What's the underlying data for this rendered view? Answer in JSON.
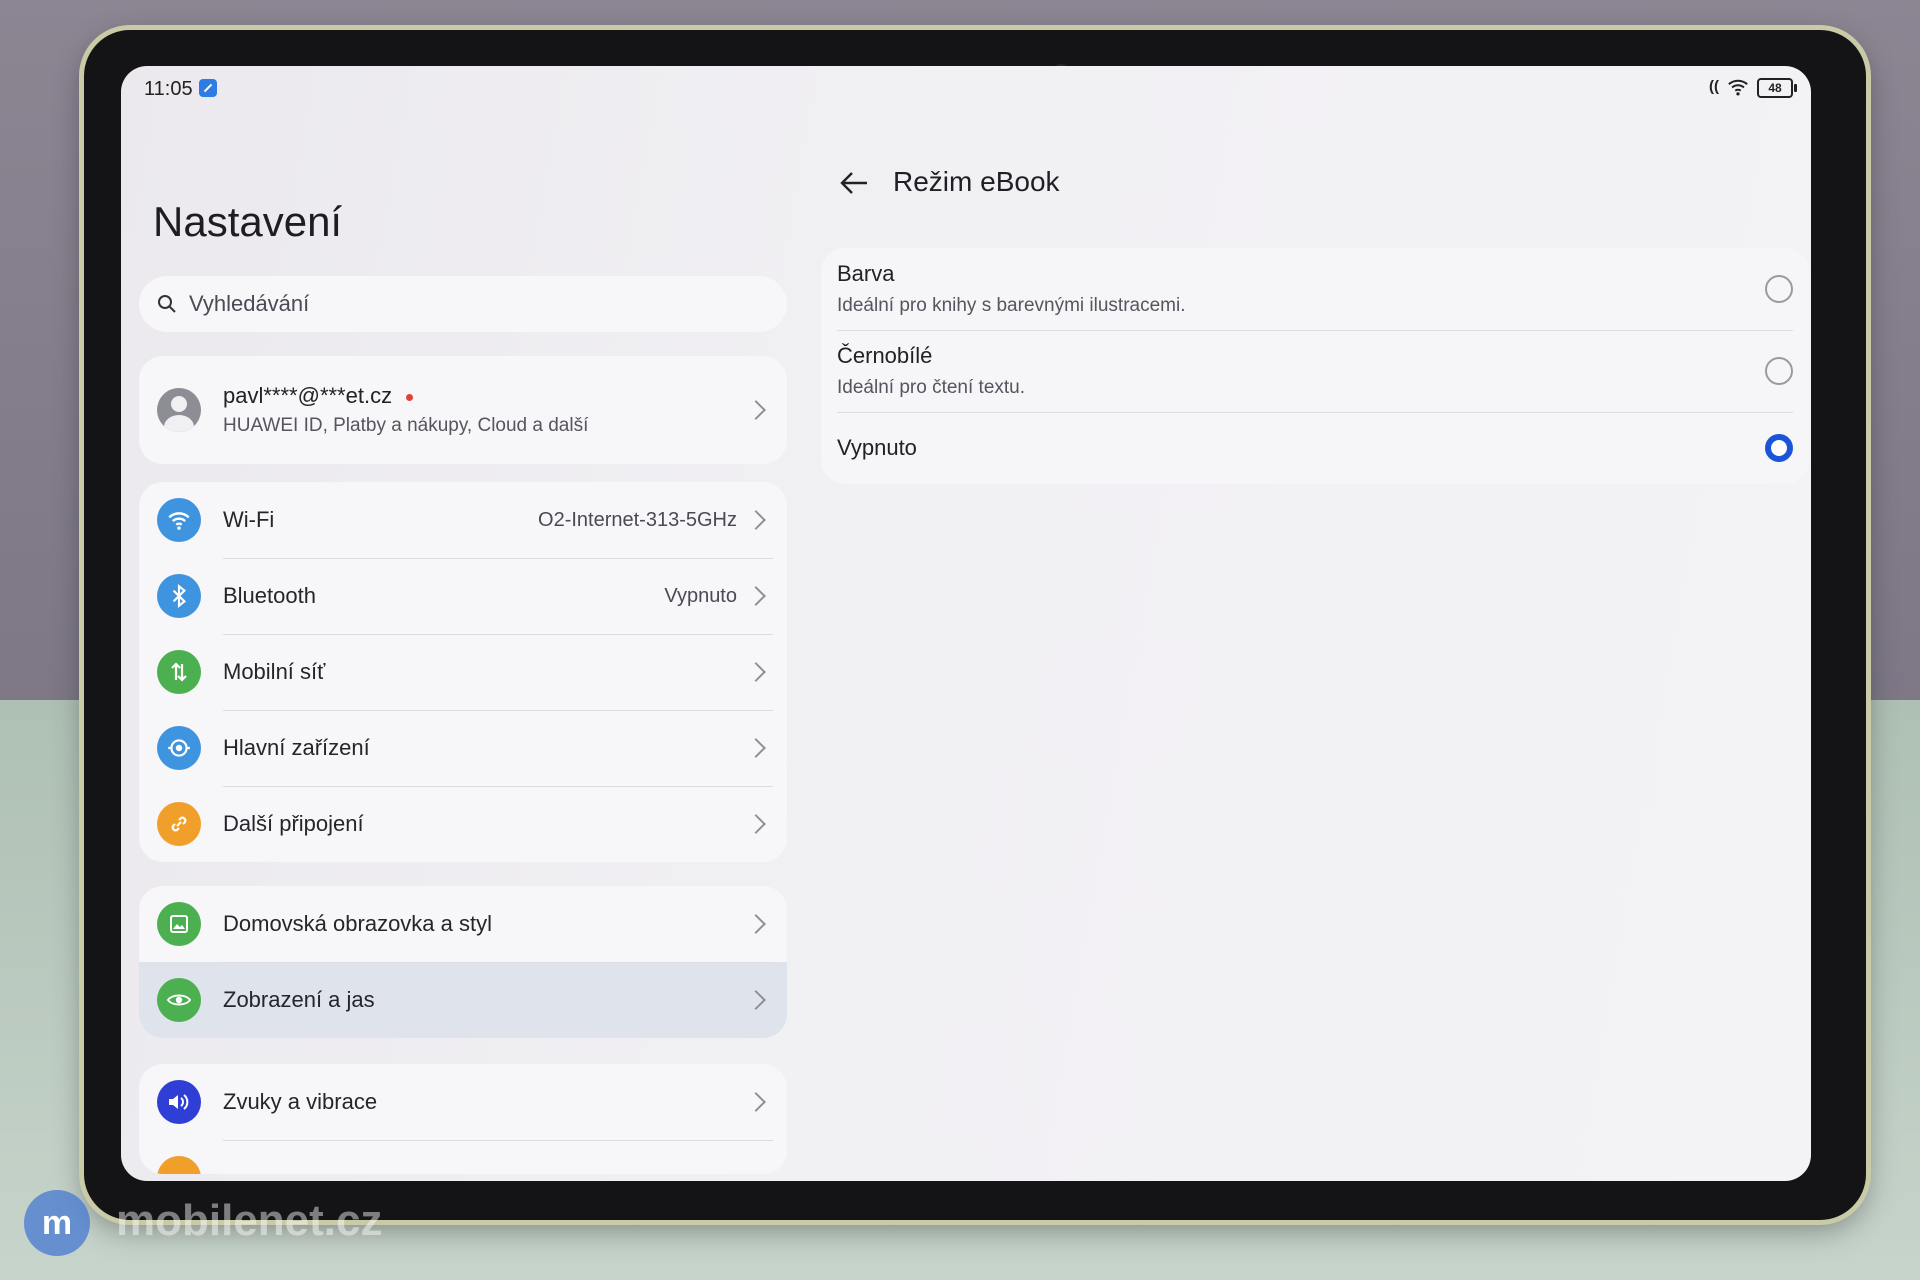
{
  "status": {
    "time": "11:05",
    "battery": "48"
  },
  "left": {
    "title": "Nastavení",
    "search_placeholder": "Vyhledávání",
    "account": {
      "name": "pavl****@***et.cz",
      "subtitle": "HUAWEI ID, Platby a nákupy, Cloud a další"
    },
    "connectivity": [
      {
        "label": "Wi-Fi",
        "value": "O2-Internet-313-5GHz",
        "icon": "wifi-icon",
        "color": "#3f94e0"
      },
      {
        "label": "Bluetooth",
        "value": "Vypnuto",
        "icon": "bluetooth-icon",
        "color": "#3f94e0"
      },
      {
        "label": "Mobilní síť",
        "value": "",
        "icon": "mobile-network-icon",
        "color": "#4caf50"
      },
      {
        "label": "Hlavní zařízení",
        "value": "",
        "icon": "main-device-icon",
        "color": "#3f94e0"
      },
      {
        "label": "Další připojení",
        "value": "",
        "icon": "link-icon",
        "color": "#f0a02a"
      }
    ],
    "display": [
      {
        "label": "Domovská obrazovka a styl",
        "icon": "home-screen-icon",
        "color": "#4caf50"
      },
      {
        "label": "Zobrazení a jas",
        "icon": "eye-icon",
        "color": "#4caf50"
      }
    ],
    "sound": [
      {
        "label": "Zvuky a vibrace",
        "icon": "speaker-icon",
        "color": "#2f3fd6"
      }
    ]
  },
  "right": {
    "title": "Režim eBook",
    "options": [
      {
        "title": "Barva",
        "subtitle": "Ideální pro knihy s barevnými ilustracemi.",
        "selected": false
      },
      {
        "title": "Černobílé",
        "subtitle": "Ideální pro čtení textu.",
        "selected": false
      },
      {
        "title": "Vypnuto",
        "subtitle": "",
        "selected": true
      }
    ]
  },
  "watermark": {
    "logo": "m",
    "text": "mobilenet.cz"
  },
  "colors": {
    "accent": "#1a54d9",
    "selected_row": "#dfe3ec"
  }
}
